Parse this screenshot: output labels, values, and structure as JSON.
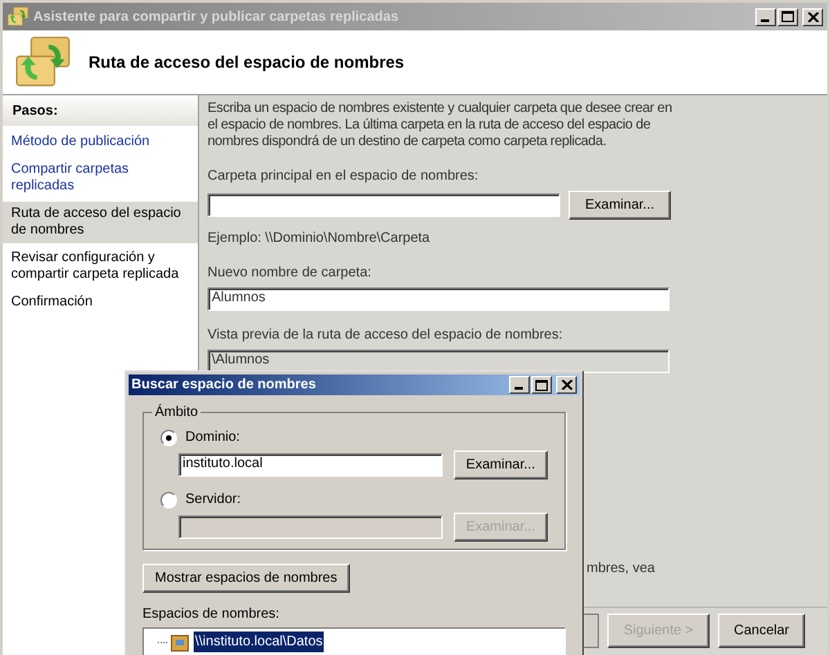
{
  "window": {
    "title": "Asistente para compartir y publicar carpetas replicadas",
    "active": false
  },
  "header": {
    "title": "Ruta de acceso del espacio de nombres"
  },
  "sidebar": {
    "heading": "Pasos:",
    "items": [
      {
        "label": "Método de publicación",
        "kind": "done",
        "selected": false
      },
      {
        "label": "Compartir carpetas replicadas",
        "kind": "done",
        "selected": false
      },
      {
        "label": "Ruta de acceso del espacio de nombres",
        "kind": "current",
        "selected": true
      },
      {
        "label": "Revisar configuración y compartir carpeta replicada",
        "kind": "pending",
        "selected": false
      },
      {
        "label": "Confirmación",
        "kind": "pending",
        "selected": false
      }
    ]
  },
  "content": {
    "instructions": "Escriba un espacio de nombres existente y cualquier carpeta que desee crear en el espacio de nombres. La última carpeta en la ruta de acceso del espacio de nombres dispondrá de un destino de carpeta como carpeta replicada.",
    "parent_folder": {
      "label": "Carpeta principal en el espacio de nombres:",
      "button": "Examinar..."
    },
    "example": "Ejemplo: \\\\Dominio\\Nombre\\Carpeta",
    "new_folder": {
      "label": "Nuevo nombre de carpeta:",
      "value": "Alumnos"
    },
    "preview": {
      "label": "Vista previa de la ruta de acceso del espacio de nombres:",
      "value": "\\Alumnos"
    },
    "partial_note": "mbres, vea"
  },
  "buttons": [
    {
      "label": "Siguiente >",
      "disabled": true
    },
    {
      "label": "Cancelar",
      "disabled": false
    }
  ],
  "dialog": {
    "title": "Buscar espacio de nombres",
    "active": true,
    "scope": {
      "label": "Ámbito",
      "options": [
        {
          "label": "Dominio:",
          "selected": true,
          "value": "instituto.local",
          "button": "Examinar...",
          "disabled": false
        },
        {
          "label": "Servidor:",
          "selected": false,
          "button": "Examinar...",
          "disabled": true
        }
      ]
    },
    "show_button": "Mostrar espacios de nombres",
    "list_label": "Espacios de nombres:",
    "namespaces": [
      {
        "label": "\\\\instituto.local\\Datos",
        "selected": true
      }
    ]
  }
}
